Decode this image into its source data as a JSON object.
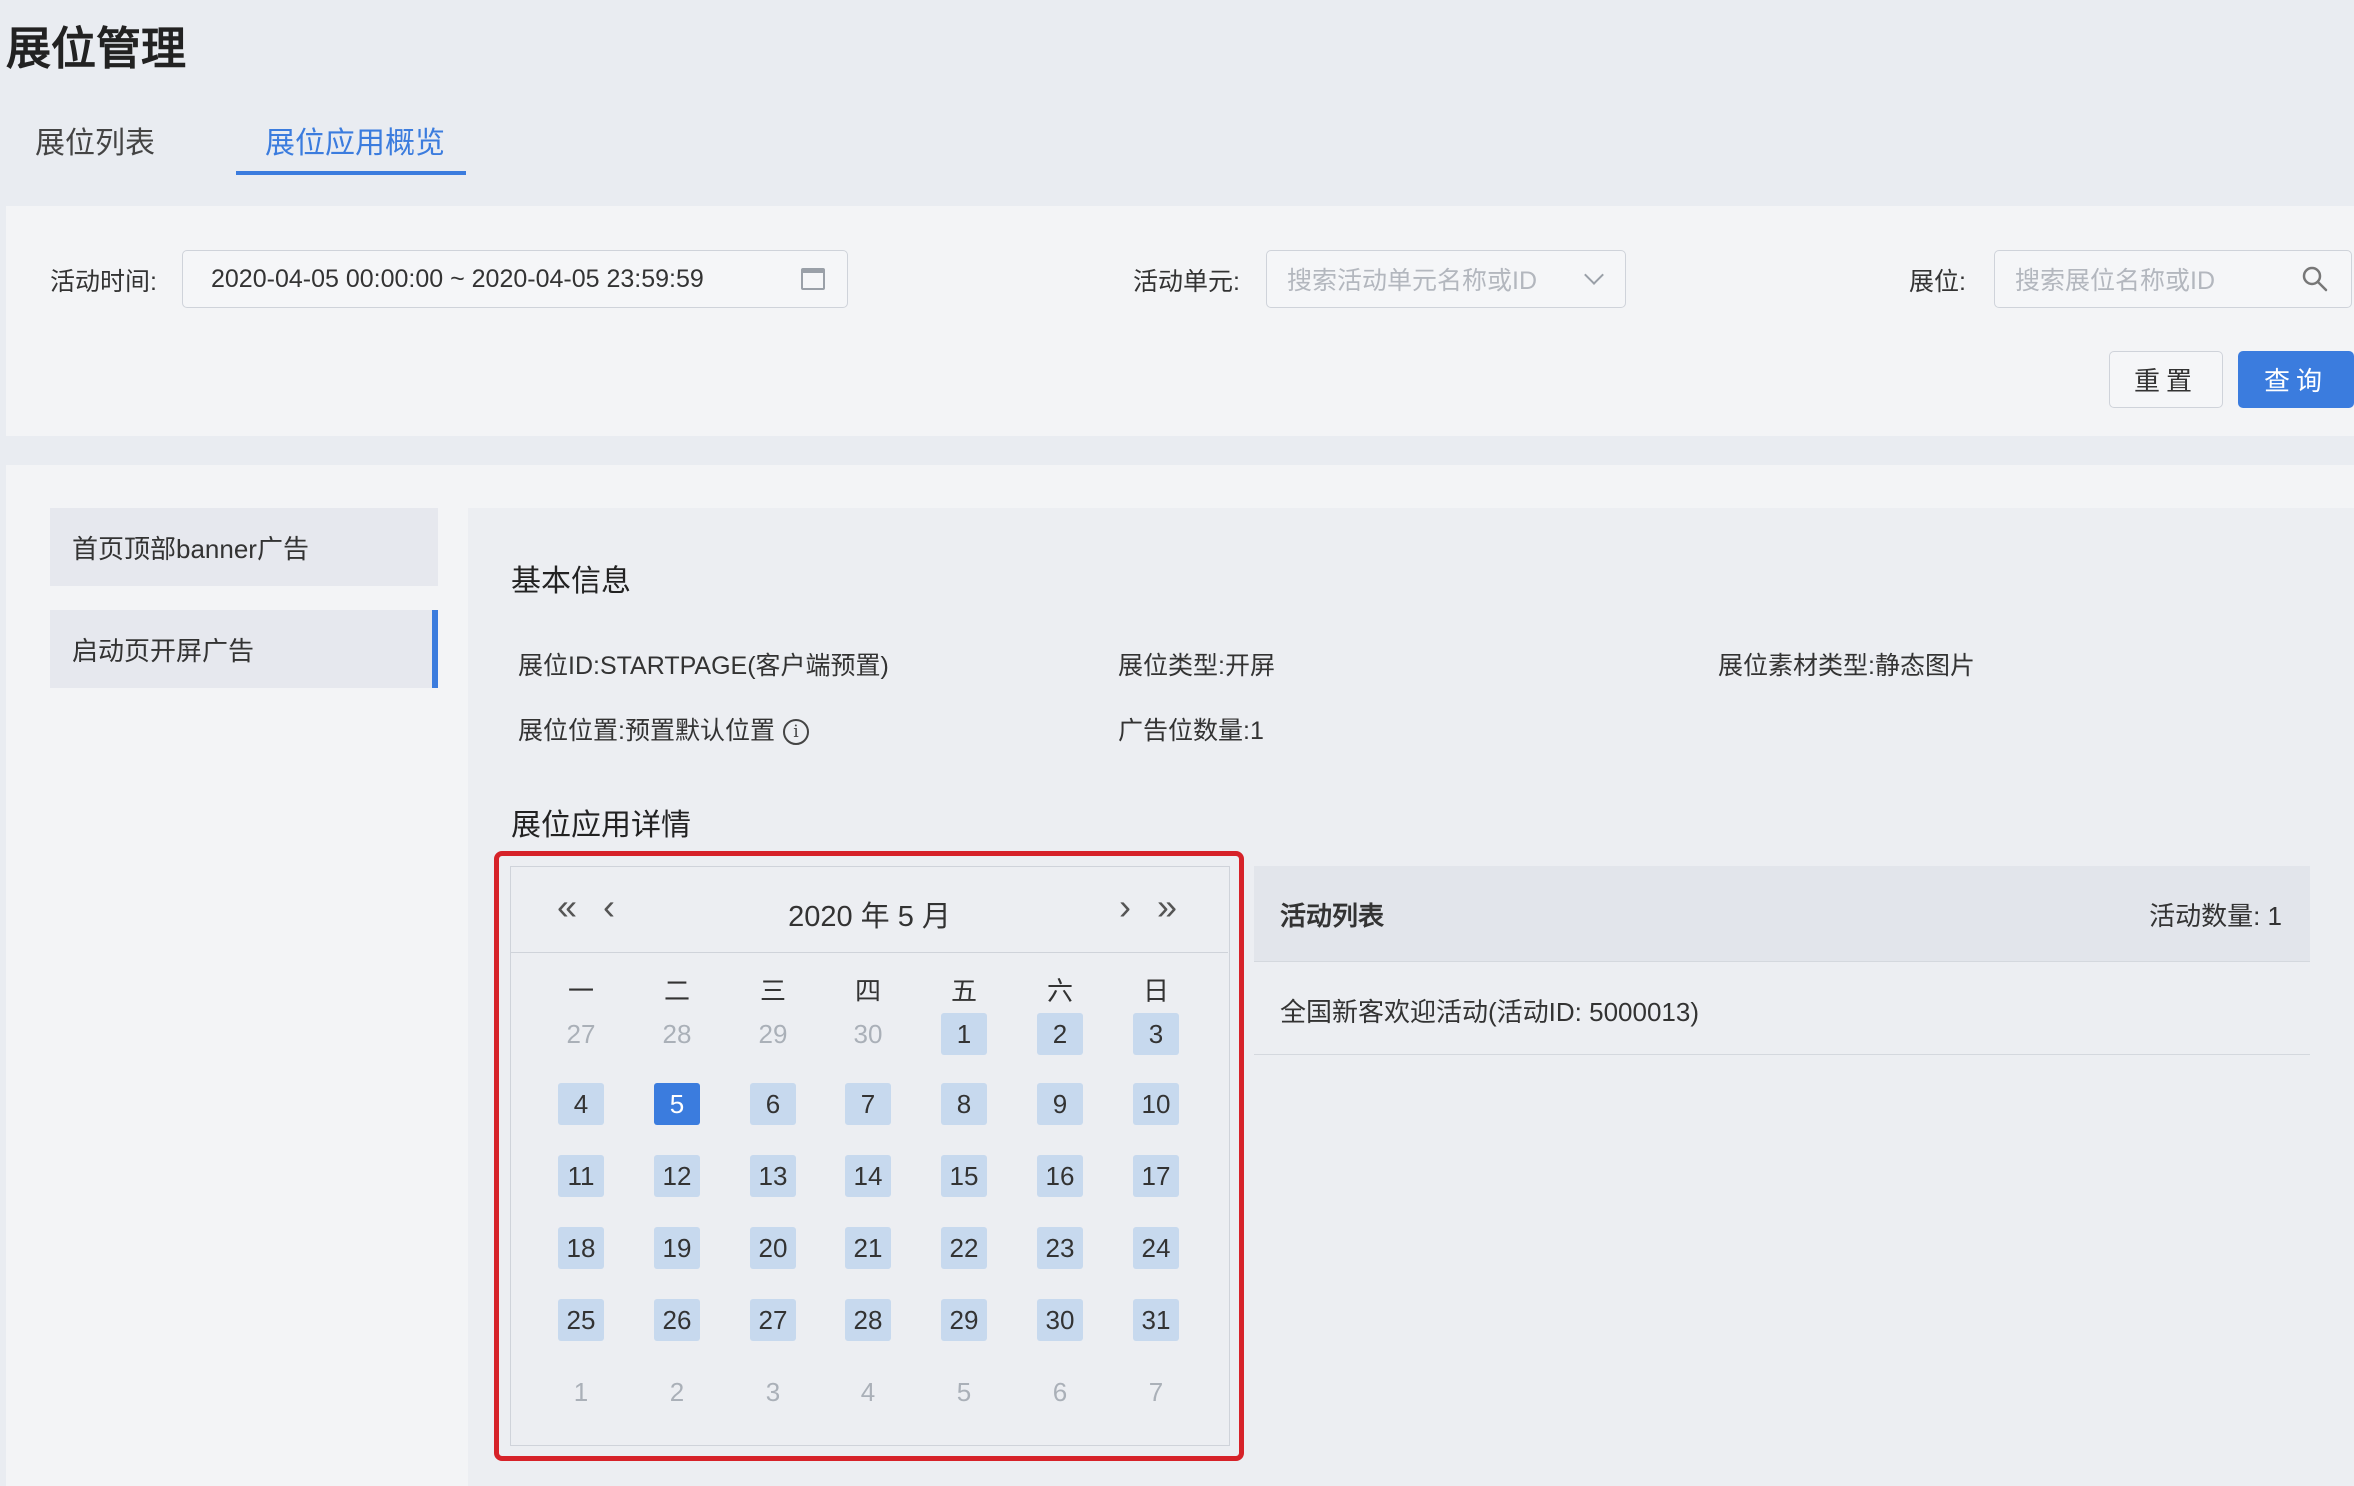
{
  "header": {
    "title": "展位管理",
    "tabs": [
      {
        "label": "展位列表"
      },
      {
        "label": "展位应用概览"
      }
    ]
  },
  "filters": {
    "time_label": "活动时间:",
    "time_value": "2020-04-05 00:00:00 ~ 2020-04-05 23:59:59",
    "unit_label": "活动单元:",
    "unit_placeholder": "搜索活动单元名称或ID",
    "slot_label": "展位:",
    "slot_placeholder": "搜索展位名称或ID",
    "reset_label": "重置",
    "query_label": "查询"
  },
  "sidebar": {
    "items": [
      {
        "label": "首页顶部banner广告"
      },
      {
        "label": "启动页开屏广告"
      }
    ]
  },
  "basic_info": {
    "title": "基本信息",
    "id_label": "展位ID:",
    "id_value": "STARTPAGE(客户端预置)",
    "type_label": "展位类型:",
    "type_value": "开屏",
    "material_label": "展位素材类型:",
    "material_value": "静态图片",
    "position_label": "展位位置:",
    "position_value": "预置默认位置",
    "count_label": "广告位数量:",
    "count_value": "1"
  },
  "detail": {
    "title": "展位应用详情"
  },
  "calendar": {
    "title": "2020 年 5 月",
    "prev_year": "«",
    "prev_month": "‹",
    "next_month": "›",
    "next_year": "»",
    "weekdays": [
      "一",
      "二",
      "三",
      "四",
      "五",
      "六",
      "日"
    ],
    "selected_day": "5",
    "weeks": [
      [
        {
          "d": "27",
          "m": "out"
        },
        {
          "d": "28",
          "m": "out"
        },
        {
          "d": "29",
          "m": "out"
        },
        {
          "d": "30",
          "m": "out"
        },
        {
          "d": "1",
          "m": "in"
        },
        {
          "d": "2",
          "m": "in"
        },
        {
          "d": "3",
          "m": "in"
        }
      ],
      [
        {
          "d": "4",
          "m": "in"
        },
        {
          "d": "5",
          "m": "sel"
        },
        {
          "d": "6",
          "m": "in"
        },
        {
          "d": "7",
          "m": "in"
        },
        {
          "d": "8",
          "m": "in"
        },
        {
          "d": "9",
          "m": "in"
        },
        {
          "d": "10",
          "m": "in"
        }
      ],
      [
        {
          "d": "11",
          "m": "in"
        },
        {
          "d": "12",
          "m": "in"
        },
        {
          "d": "13",
          "m": "in"
        },
        {
          "d": "14",
          "m": "in"
        },
        {
          "d": "15",
          "m": "in"
        },
        {
          "d": "16",
          "m": "in"
        },
        {
          "d": "17",
          "m": "in"
        }
      ],
      [
        {
          "d": "18",
          "m": "in"
        },
        {
          "d": "19",
          "m": "in"
        },
        {
          "d": "20",
          "m": "in"
        },
        {
          "d": "21",
          "m": "in"
        },
        {
          "d": "22",
          "m": "in"
        },
        {
          "d": "23",
          "m": "in"
        },
        {
          "d": "24",
          "m": "in"
        }
      ],
      [
        {
          "d": "25",
          "m": "in"
        },
        {
          "d": "26",
          "m": "in"
        },
        {
          "d": "27",
          "m": "in"
        },
        {
          "d": "28",
          "m": "in"
        },
        {
          "d": "29",
          "m": "in"
        },
        {
          "d": "30",
          "m": "in"
        },
        {
          "d": "31",
          "m": "in"
        }
      ],
      [
        {
          "d": "1",
          "m": "out"
        },
        {
          "d": "2",
          "m": "out"
        },
        {
          "d": "3",
          "m": "out"
        },
        {
          "d": "4",
          "m": "out"
        },
        {
          "d": "5",
          "m": "out"
        },
        {
          "d": "6",
          "m": "out"
        },
        {
          "d": "7",
          "m": "out"
        }
      ]
    ]
  },
  "activities": {
    "title": "活动列表",
    "count_text": "活动数量: 1",
    "items": [
      {
        "label": "全国新客欢迎活动(活动ID: 5000013)"
      }
    ]
  },
  "colors": {
    "accent": "#3b7cde",
    "highlight": "#d62229",
    "in_month_cell": "#c7d9ee"
  }
}
